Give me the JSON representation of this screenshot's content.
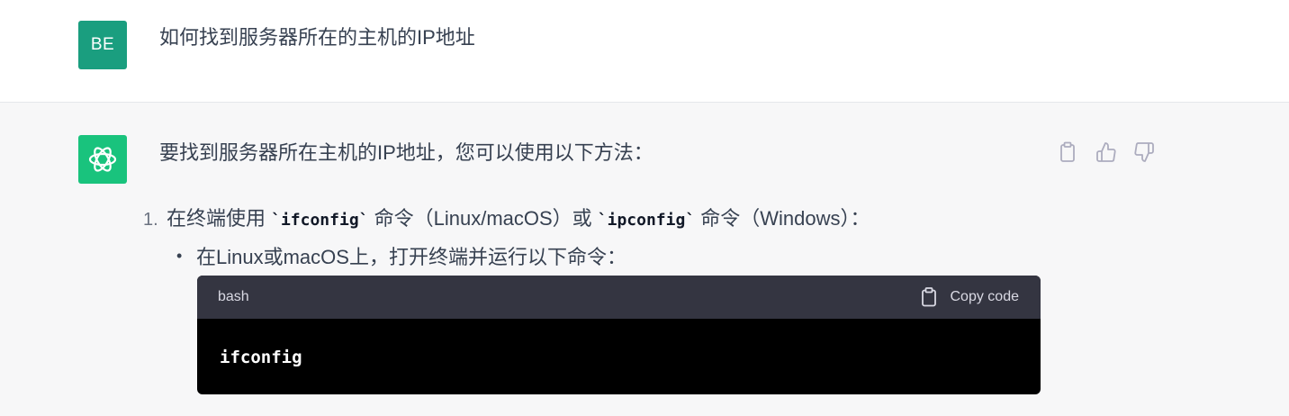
{
  "user_message": {
    "avatar_initials": "BE",
    "text": "如何找到服务器所在的主机的IP地址"
  },
  "assistant_message": {
    "intro": "要找到服务器所在主机的IP地址，您可以使用以下方法：",
    "actions": {
      "copy_icon": "clipboard-icon",
      "like_icon": "thumbs-up-icon",
      "dislike_icon": "thumbs-down-icon"
    },
    "list": [
      {
        "number": "1.",
        "text_before": "在终端使用 ",
        "code1": "`ifconfig`",
        "text_middle": " 命令（Linux/macOS）或 ",
        "code2": "`ipconfig`",
        "text_after": " 命令（Windows）：",
        "bullets": [
          {
            "symbol": "•",
            "text": "在Linux或macOS上，打开终端并运行以下命令："
          }
        ]
      }
    ],
    "code_block": {
      "language": "bash",
      "copy_label": "Copy code",
      "code": "ifconfig"
    }
  },
  "colors": {
    "user_avatar_bg": "#1a9e7f",
    "assistant_avatar_bg": "#19c37d",
    "assistant_row_bg": "#f7f7f8",
    "code_header_bg": "#343541",
    "code_body_bg": "#000000"
  }
}
